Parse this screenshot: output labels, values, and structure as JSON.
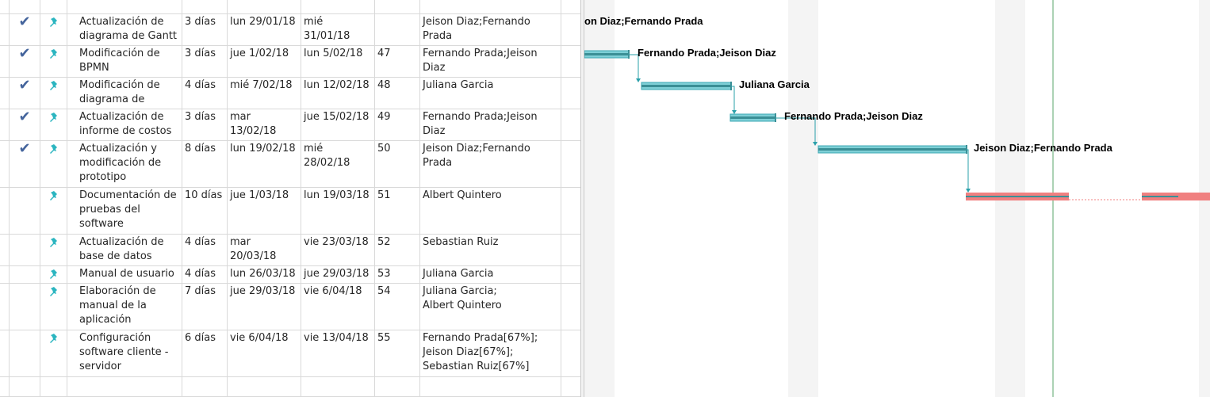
{
  "tasks": [
    {
      "done": true,
      "pinned": true,
      "name": "Actualización de\ndiagrama de Gantt",
      "duration": "3 días",
      "start": "lun 29/01/18",
      "finish": "mié 31/01/18",
      "predecessors": "",
      "resources": "Jeison Diaz;Fernando Prada"
    },
    {
      "done": true,
      "pinned": true,
      "name": "Modificación de\nBPMN",
      "duration": "3 días",
      "start": "jue 1/02/18",
      "finish": "lun 5/02/18",
      "predecessors": "47",
      "resources": "Fernando Prada;Jeison Diaz"
    },
    {
      "done": true,
      "pinned": true,
      "name": "Modificación de\ndiagrama de clases",
      "duration": "4 días",
      "start": "mié 7/02/18",
      "finish": "lun 12/02/18",
      "predecessors": "48",
      "resources": "Juliana Garcia"
    },
    {
      "done": true,
      "pinned": true,
      "name": "Actualización de\ninforme de costos",
      "duration": "3 días",
      "start": "mar 13/02/18",
      "finish": "jue 15/02/18",
      "predecessors": "49",
      "resources": "Fernando Prada;Jeison Diaz"
    },
    {
      "done": true,
      "pinned": true,
      "name": "Actualización y\nmodificación de\nprototipo",
      "duration": "8 días",
      "start": "lun 19/02/18",
      "finish": "mié 28/02/18",
      "predecessors": "50",
      "resources": "Jeison Diaz;Fernando Prada"
    },
    {
      "done": false,
      "pinned": true,
      "name": "Documentación de\npruebas del\nsoftware",
      "duration": "10 días",
      "start": "jue 1/03/18",
      "finish": "lun 19/03/18",
      "predecessors": "51",
      "resources": "Albert Quintero"
    },
    {
      "done": false,
      "pinned": true,
      "name": "Actualización de\nbase de datos",
      "duration": "4 días",
      "start": "mar 20/03/18",
      "finish": "vie 23/03/18",
      "predecessors": "52",
      "resources": "Sebastian Ruiz"
    },
    {
      "done": false,
      "pinned": true,
      "name": "Manual de usuario",
      "duration": "4 días",
      "start": "lun 26/03/18",
      "finish": "jue 29/03/18",
      "predecessors": "53",
      "resources": "Juliana Garcia"
    },
    {
      "done": false,
      "pinned": true,
      "name": "Elaboración de\nmanual de la\naplicación",
      "duration": "7 días",
      "start": "jue 29/03/18",
      "finish": "vie 6/04/18",
      "predecessors": "54",
      "resources": "Juliana Garcia;\nAlbert Quintero"
    },
    {
      "done": false,
      "pinned": true,
      "name": "Configuración\nsoftware cliente -\nservidor",
      "duration": "6 días",
      "start": "vie 6/04/18",
      "finish": "vie 13/04/18",
      "predecessors": "55",
      "resources": "Fernando Prada[67%];\nJeison Diaz[67%];\nSebastian Ruiz[67%]"
    }
  ],
  "gantt_labels": [
    "on Diaz;Fernando Prada",
    "Fernando Prada;Jeison Diaz",
    "Juliana Garcia",
    "Fernando Prada;Jeison Diaz",
    "Jeison Diaz;Fernando Prada"
  ],
  "colors": {
    "done_bar": "#3ea9b4",
    "done_bar_fill": "#7ecfd6",
    "critical_bar": "#f08080",
    "progress_line": "#3a8f96",
    "link": "#2aa0aa",
    "checkmark": "#44649c",
    "pin": "#2bb5c0",
    "grid_line": "#d9d9d9",
    "status_date_line": "#5aa66a"
  },
  "icons": {
    "done": "checkmark-icon",
    "pinned": "pushpin-icon"
  }
}
